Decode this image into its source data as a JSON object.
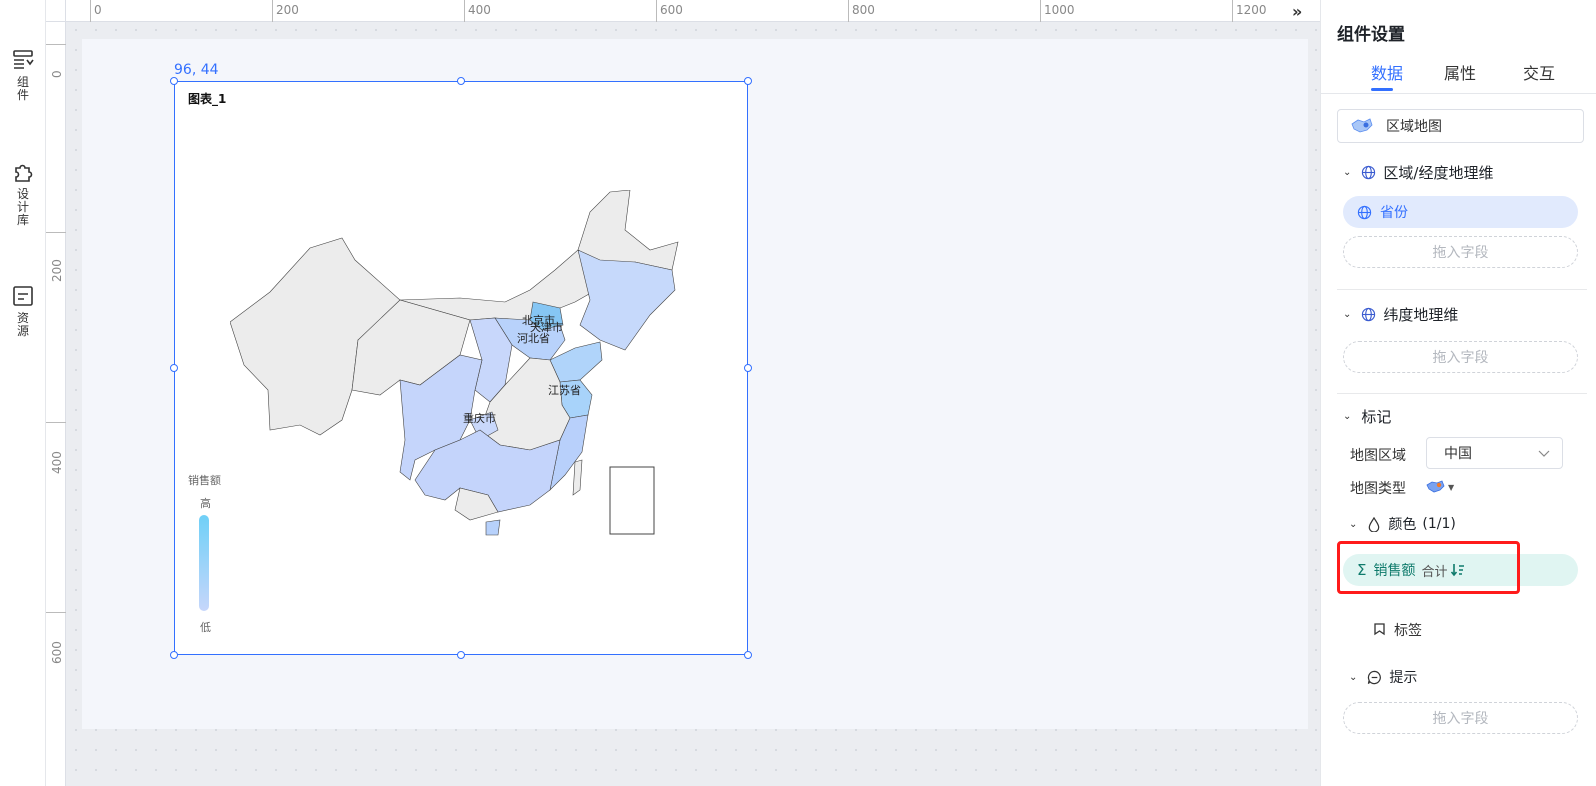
{
  "rail": {
    "items": [
      {
        "label": "组件",
        "icon": "components-icon"
      },
      {
        "label": "设计库",
        "icon": "puzzle-icon"
      },
      {
        "label": "资源",
        "icon": "resource-icon"
      }
    ]
  },
  "ruler": {
    "x_labels": [
      "0",
      "200",
      "400",
      "600",
      "800",
      "1000",
      "1200"
    ],
    "y_labels": [
      "0",
      "200",
      "400",
      "600"
    ],
    "collapse_glyph": "»"
  },
  "canvas": {
    "coord_readout": "96, 44",
    "chart_title": "图表_1",
    "legend": {
      "title": "销售额",
      "high": "高",
      "low": "低",
      "color_high": "#6fd0f7",
      "color_low": "#c6d6fb"
    },
    "map_labels": [
      "北京市",
      "天津市",
      "河北省",
      "江苏省",
      "重庆市"
    ]
  },
  "panel": {
    "title": "组件设置",
    "tabs": [
      "数据",
      "属性",
      "交互"
    ],
    "active_tab": "数据",
    "chart_type": "区域地图",
    "section_region": "区域/经度地理维",
    "region_field": "省份",
    "dropzone": "拖入字段",
    "section_lat": "纬度地理维",
    "section_mark": "标记",
    "map_region_label": "地图区域",
    "map_region_value": "中国",
    "map_type_label": "地图类型",
    "color_label": "颜色",
    "color_count": "(1/1)",
    "measure_field": "销售额",
    "measure_agg": "合计",
    "label_item": "标签",
    "section_tooltip": "提示",
    "accent": "#3370ff",
    "highlight_color": "#ff1b1b"
  }
}
